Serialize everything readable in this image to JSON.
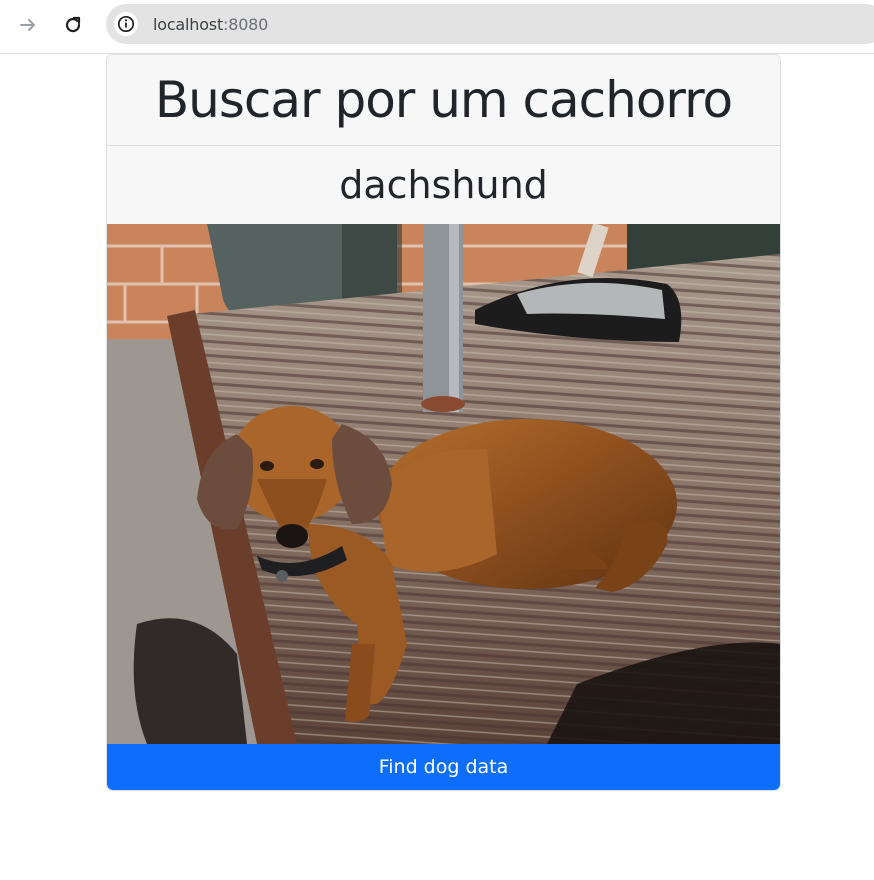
{
  "browser": {
    "url_host": "localhost",
    "url_port": ":8080"
  },
  "page": {
    "title": "Buscar por um cachorro",
    "breed": "dachshund",
    "photo": {
      "subject": "dachshund dog standing on a wooden deck",
      "icon": "dog-photo"
    },
    "find_button_label": "Find dog data"
  },
  "colors": {
    "primary_button": "#0d6efd",
    "header_bg": "#f7f7f7",
    "text": "#212529"
  }
}
